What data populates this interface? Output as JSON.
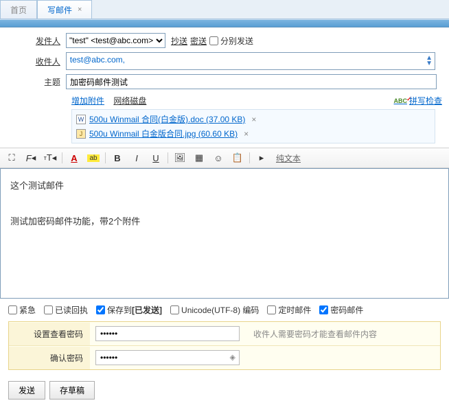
{
  "tabs": {
    "home": "首页",
    "compose": "写邮件"
  },
  "form": {
    "sender_label": "发件人",
    "sender_value": "\"test\" <test@abc.com>",
    "cc": "抄送",
    "bcc": "密送",
    "separate_send": "分别发送",
    "recipient_label": "收件人",
    "recipient_value": "test@abc.com,",
    "subject_label": "主题",
    "subject_value": "加密码邮件测试",
    "add_attachment": "增加附件",
    "netdisk": "网络磁盘",
    "spellcheck": "拼写检查"
  },
  "attachments": [
    {
      "icon": "doc",
      "name": "500u Winmail 合同(白金版).doc (37.00 KB)"
    },
    {
      "icon": "jpg",
      "name": "500u Winmail 白金版合同.jpg (60.60 KB)"
    }
  ],
  "toolbar": {
    "plain_text": "纯文本"
  },
  "body": {
    "line1": "这个测试邮件",
    "line2": "测试加密码邮件功能，带2个附件"
  },
  "options": {
    "urgent": "紧急",
    "receipt": "已读回执",
    "save_to_prefix": "保存到",
    "save_to_bold": "[已发送]",
    "encoding": "Unicode(UTF-8) 编码",
    "scheduled": "定时邮件",
    "password_mail": "密码邮件",
    "save_checked": true,
    "password_checked": true
  },
  "password": {
    "view_label": "设置查看密码",
    "confirm_label": "确认密码",
    "value": "●●●●●●",
    "hint": "收件人需要密码才能查看邮件内容"
  },
  "actions": {
    "send": "发送",
    "draft": "存草稿"
  }
}
